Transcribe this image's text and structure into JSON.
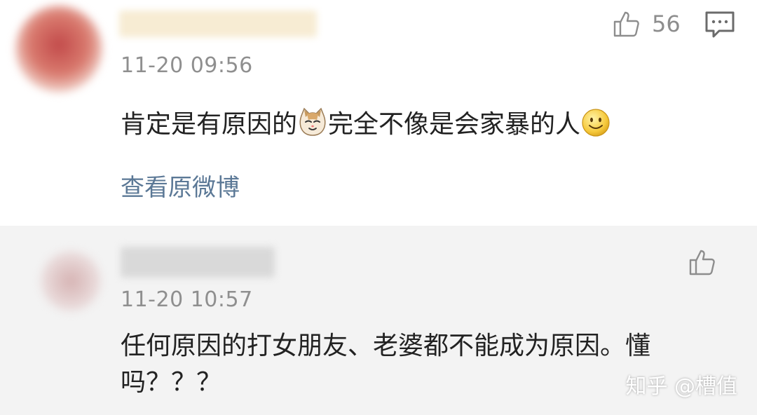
{
  "comments": [
    {
      "time": "11-20 09:56",
      "likes": "56",
      "text_part1": "肯定是有原因的",
      "text_part2": "完全不像是会家暴的人",
      "emoji1": "cat-face-icon",
      "emoji2": "smile-face-icon",
      "link": "查看原微博"
    },
    {
      "time": "11-20 10:57",
      "text": "任何原因的打女朋友、老婆都不能成为原因。懂吗？？？"
    }
  ],
  "watermark": "知乎 @槽值",
  "colors": {
    "link": "#5b7896",
    "time": "#8f8f8f",
    "second_bg": "#f3f3f3"
  }
}
